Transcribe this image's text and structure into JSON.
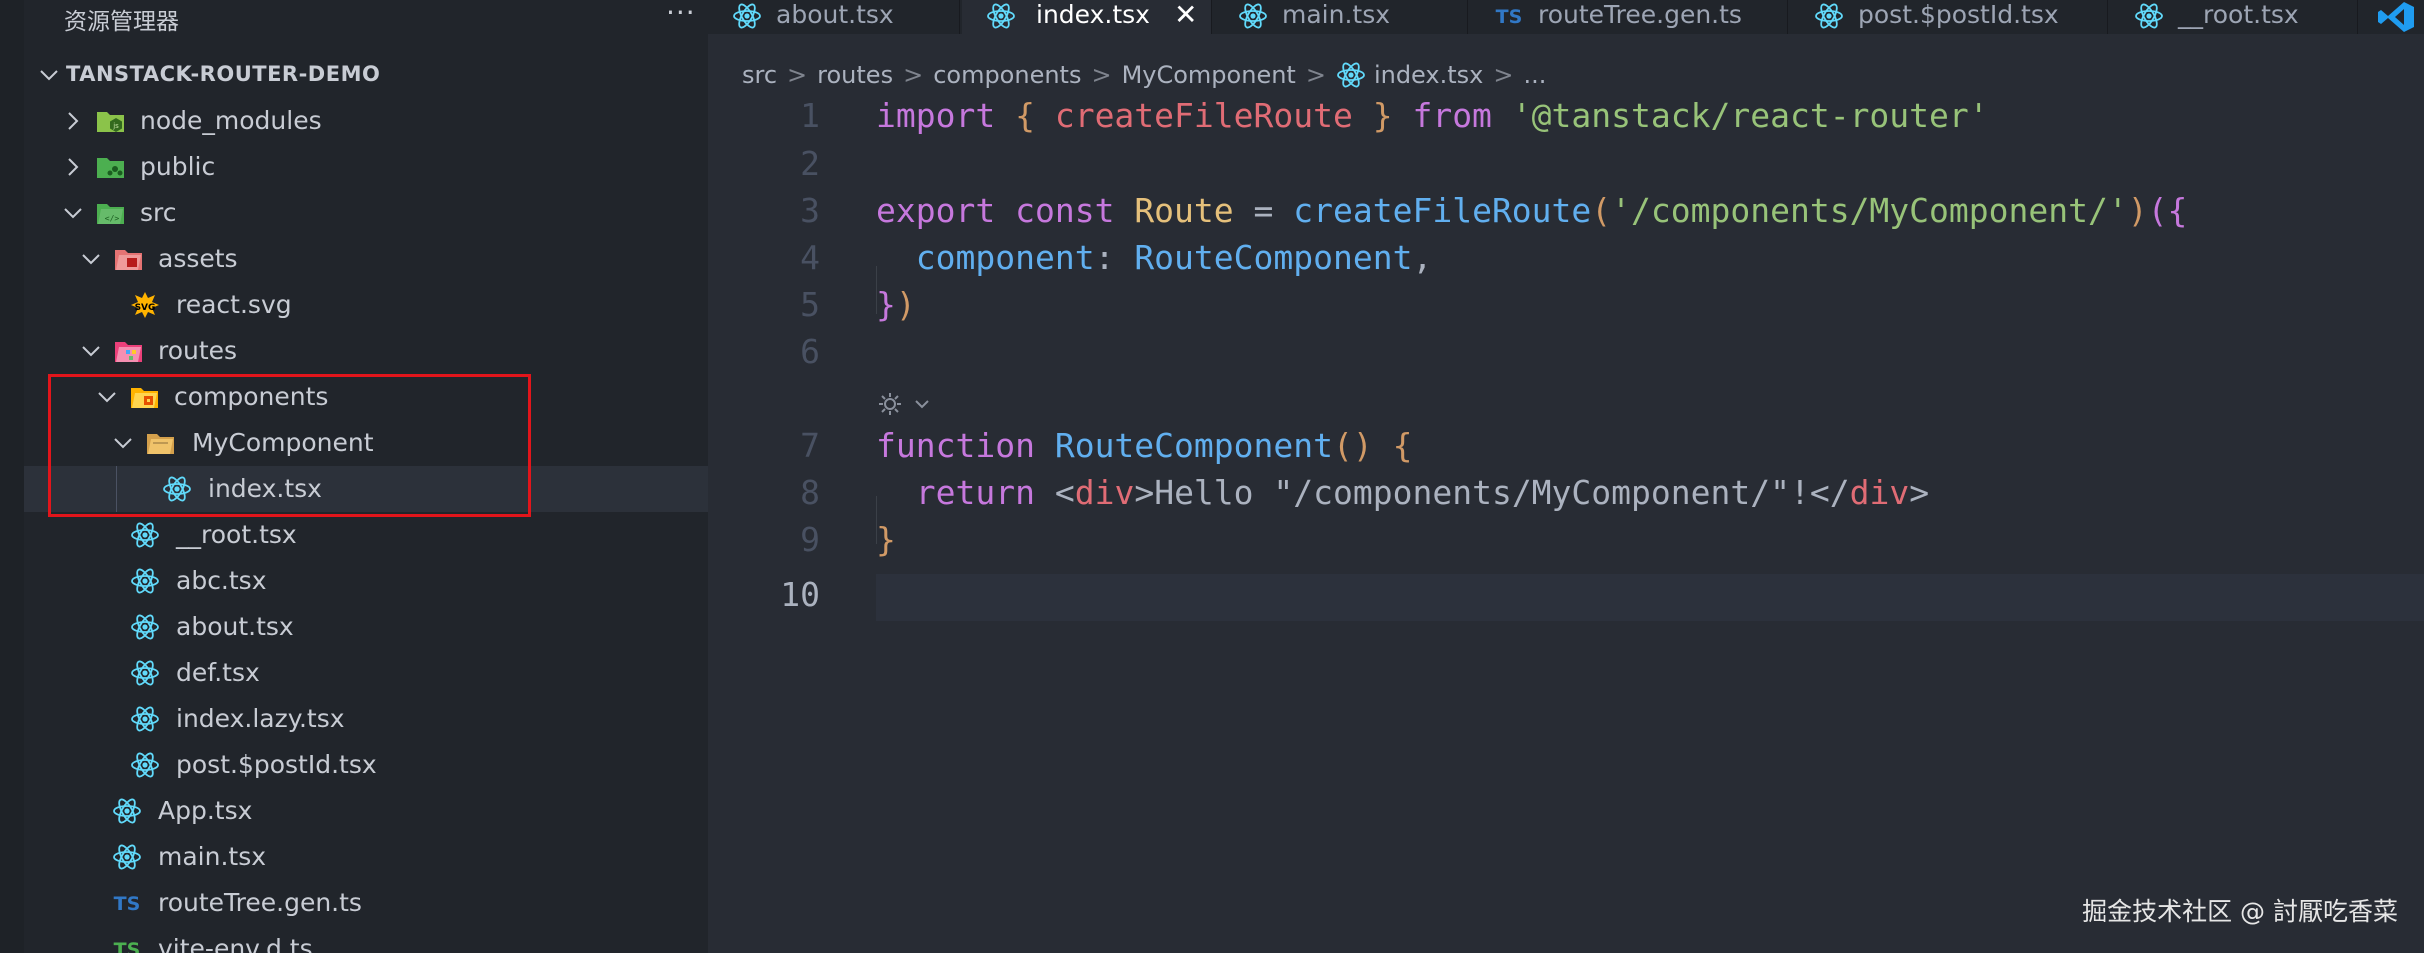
{
  "sidebar": {
    "title": "资源管理器",
    "more": "···",
    "project_name": "TANSTACK-ROUTER-DEMO",
    "tree": [
      {
        "label": "node_modules",
        "icon": "node-modules-folder-icon",
        "expanded": false
      },
      {
        "label": "public",
        "icon": "public-folder-icon",
        "expanded": false
      },
      {
        "label": "src",
        "icon": "src-folder-icon",
        "expanded": true
      },
      {
        "label": "assets",
        "icon": "assets-folder-icon",
        "expanded": true
      },
      {
        "label": "react.svg",
        "icon": "svg-file-icon"
      },
      {
        "label": "routes",
        "icon": "routes-folder-icon",
        "expanded": true
      },
      {
        "label": "components",
        "icon": "components-folder-icon",
        "expanded": true
      },
      {
        "label": "MyComponent",
        "icon": "folder-open-icon",
        "expanded": true
      },
      {
        "label": "index.tsx",
        "icon": "react-icon",
        "selected": true
      },
      {
        "label": "__root.tsx",
        "icon": "react-icon"
      },
      {
        "label": "abc.tsx",
        "icon": "react-icon"
      },
      {
        "label": "about.tsx",
        "icon": "react-icon"
      },
      {
        "label": "def.tsx",
        "icon": "react-icon"
      },
      {
        "label": "index.lazy.tsx",
        "icon": "react-icon"
      },
      {
        "label": "post.$postId.tsx",
        "icon": "react-icon"
      },
      {
        "label": "App.tsx",
        "icon": "react-icon"
      },
      {
        "label": "main.tsx",
        "icon": "react-icon"
      },
      {
        "label": "routeTree.gen.ts",
        "icon": "typescript-icon"
      },
      {
        "label": "vite-env.d.ts",
        "icon": "typescript-icon"
      }
    ]
  },
  "tabs": [
    {
      "label": "about.tsx",
      "icon": "react-icon",
      "active": false
    },
    {
      "label": "index.tsx",
      "icon": "react-icon",
      "active": true,
      "close": "✕"
    },
    {
      "label": "main.tsx",
      "icon": "react-icon",
      "active": false
    },
    {
      "label": "routeTree.gen.ts",
      "icon": "typescript-icon",
      "active": false
    },
    {
      "label": "post.$postId.tsx",
      "icon": "react-icon",
      "active": false
    },
    {
      "label": "__root.tsx",
      "icon": "react-icon",
      "active": false
    }
  ],
  "breadcrumb": {
    "items": [
      "src",
      "routes",
      "components",
      "MyComponent",
      "index.tsx",
      "..."
    ],
    "separator": ">"
  },
  "editor": {
    "line_numbers": [
      "1",
      "2",
      "3",
      "4",
      "5",
      "6",
      "7",
      "8",
      "9",
      "10"
    ],
    "active_line": "10",
    "code": {
      "l1": [
        "import",
        " { ",
        "createFileRoute",
        " } ",
        "from",
        " ",
        "'@tanstack/react-router'"
      ],
      "l3": [
        "export",
        " ",
        "const",
        " ",
        "Route",
        " = ",
        "createFileRoute",
        "(",
        "'/components/MyComponent/'",
        ")",
        "({"
      ],
      "l4": [
        "  ",
        "component",
        ": ",
        "RouteComponent",
        ","
      ],
      "l5": [
        "}",
        ")"
      ],
      "l7": [
        "function",
        " ",
        "RouteComponent",
        "()",
        " {"
      ],
      "l8": [
        "  ",
        "return",
        " <",
        "div",
        ">Hello \"/components/MyComponent/\"!</",
        "div",
        ">"
      ],
      "l9": [
        "}"
      ]
    }
  },
  "watermark": "掘金技术社区 @ 討厭吃香菜",
  "colors": {
    "keyword": "#c678dd",
    "function": "#61afef",
    "variable": "#e5c07b",
    "string": "#98c379",
    "highlight_box": "#e2151b"
  }
}
